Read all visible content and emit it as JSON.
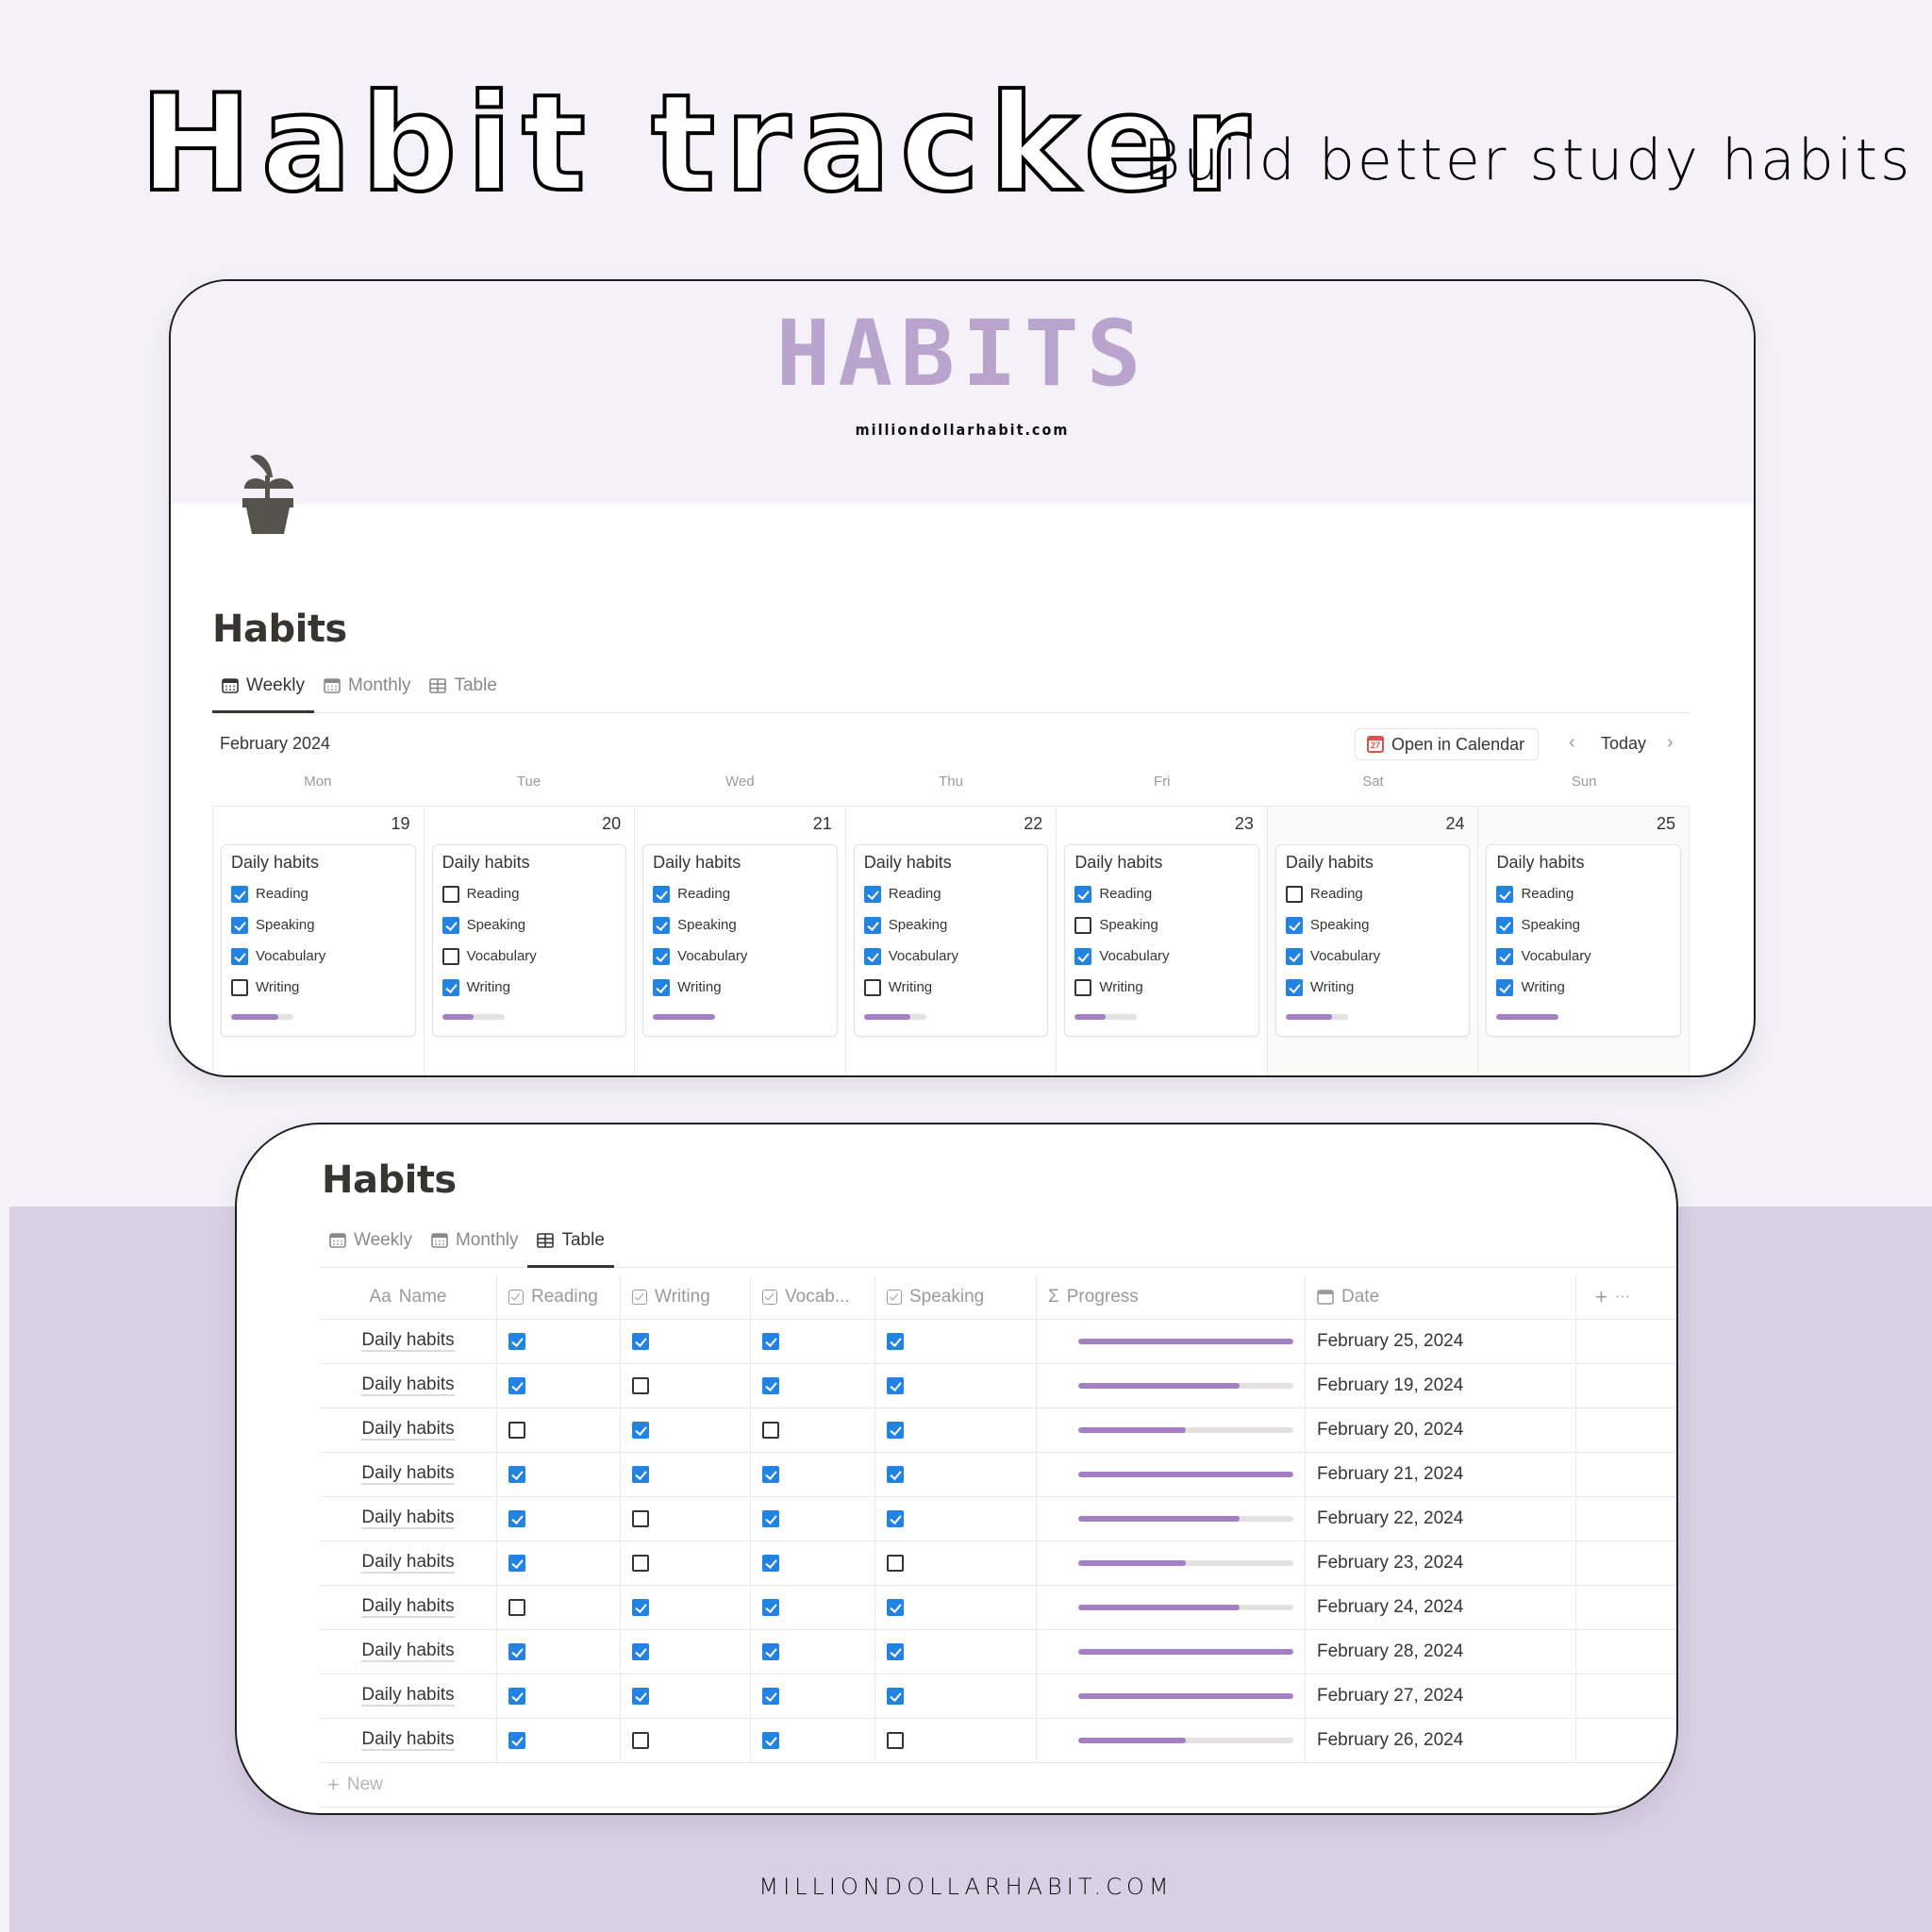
{
  "hero": {
    "title": "Habit tracker",
    "subtitle": "Build better study habits"
  },
  "footer": {
    "url": "MILLIONDOLLARHABIT.COM"
  },
  "colors": {
    "accent": "#a47fc6",
    "checkbox": "#2383e2",
    "cover_title": "#b8a4cd",
    "lavender_bg": "#d9d0e4"
  },
  "calendar_view": {
    "cover_title": "HABITS",
    "cover_url": "milliondollarhabit.com",
    "page_icon": "plant-pot-icon",
    "page_title": "Habits",
    "tabs": [
      {
        "label": "Weekly",
        "icon": "calendar-icon",
        "active": true
      },
      {
        "label": "Monthly",
        "icon": "calendar-icon",
        "active": false
      },
      {
        "label": "Table",
        "icon": "table-icon",
        "active": false
      }
    ],
    "month_label": "February 2024",
    "open_in_calendar": "Open in Calendar",
    "calendar_icon_day": "27",
    "today_label": "Today",
    "prev_icon": "‹",
    "next_icon": "›",
    "weekdays": [
      "Mon",
      "Tue",
      "Wed",
      "Thu",
      "Fri",
      "Sat",
      "Sun"
    ],
    "habit_labels": [
      "Reading",
      "Speaking",
      "Vocabulary",
      "Writing"
    ],
    "days": [
      {
        "day": "19",
        "title": "Daily habits",
        "weekend": false,
        "checks": [
          true,
          true,
          true,
          false
        ],
        "progress": 0.75
      },
      {
        "day": "20",
        "title": "Daily habits",
        "weekend": false,
        "checks": [
          false,
          true,
          false,
          true
        ],
        "progress": 0.5
      },
      {
        "day": "21",
        "title": "Daily habits",
        "weekend": false,
        "checks": [
          true,
          true,
          true,
          true
        ],
        "progress": 1.0
      },
      {
        "day": "22",
        "title": "Daily habits",
        "weekend": false,
        "checks": [
          true,
          true,
          true,
          false
        ],
        "progress": 0.75
      },
      {
        "day": "23",
        "title": "Daily habits",
        "weekend": false,
        "checks": [
          true,
          false,
          true,
          false
        ],
        "progress": 0.5
      },
      {
        "day": "24",
        "title": "Daily habits",
        "weekend": true,
        "checks": [
          false,
          true,
          true,
          true
        ],
        "progress": 0.75
      },
      {
        "day": "25",
        "title": "Daily habits",
        "weekend": true,
        "checks": [
          true,
          true,
          true,
          true
        ],
        "progress": 1.0
      }
    ]
  },
  "table_view": {
    "page_title": "Habits",
    "tabs": [
      {
        "label": "Weekly",
        "icon": "calendar-icon",
        "active": false
      },
      {
        "label": "Monthly",
        "icon": "calendar-icon",
        "active": false
      },
      {
        "label": "Table",
        "icon": "table-icon",
        "active": true
      }
    ],
    "columns": {
      "name": "Name",
      "name_prefix": "Aa",
      "reading": "Reading",
      "writing": "Writing",
      "vocab": "Vocab...",
      "speaking": "Speaking",
      "progress": "Progress",
      "progress_prefix": "Σ",
      "date": "Date"
    },
    "add_icon": "+",
    "more_icon": "···",
    "rows": [
      {
        "name": "Daily habits",
        "reading": true,
        "writing": true,
        "vocab": true,
        "speaking": true,
        "progress": 1.0,
        "date": "February 25, 2024"
      },
      {
        "name": "Daily habits",
        "reading": true,
        "writing": false,
        "vocab": true,
        "speaking": true,
        "progress": 0.75,
        "date": "February 19, 2024"
      },
      {
        "name": "Daily habits",
        "reading": false,
        "writing": true,
        "vocab": false,
        "speaking": true,
        "progress": 0.5,
        "date": "February 20, 2024"
      },
      {
        "name": "Daily habits",
        "reading": true,
        "writing": true,
        "vocab": true,
        "speaking": true,
        "progress": 1.0,
        "date": "February 21, 2024"
      },
      {
        "name": "Daily habits",
        "reading": true,
        "writing": false,
        "vocab": true,
        "speaking": true,
        "progress": 0.75,
        "date": "February 22, 2024"
      },
      {
        "name": "Daily habits",
        "reading": true,
        "writing": false,
        "vocab": true,
        "speaking": false,
        "progress": 0.5,
        "date": "February 23, 2024"
      },
      {
        "name": "Daily habits",
        "reading": false,
        "writing": true,
        "vocab": true,
        "speaking": true,
        "progress": 0.75,
        "date": "February 24, 2024"
      },
      {
        "name": "Daily habits",
        "reading": true,
        "writing": true,
        "vocab": true,
        "speaking": true,
        "progress": 1.0,
        "date": "February 28, 2024"
      },
      {
        "name": "Daily habits",
        "reading": true,
        "writing": true,
        "vocab": true,
        "speaking": true,
        "progress": 1.0,
        "date": "February 27, 2024"
      },
      {
        "name": "Daily habits",
        "reading": true,
        "writing": false,
        "vocab": true,
        "speaking": false,
        "progress": 0.5,
        "date": "February 26, 2024"
      }
    ],
    "new_label": "New",
    "new_icon": "+"
  }
}
